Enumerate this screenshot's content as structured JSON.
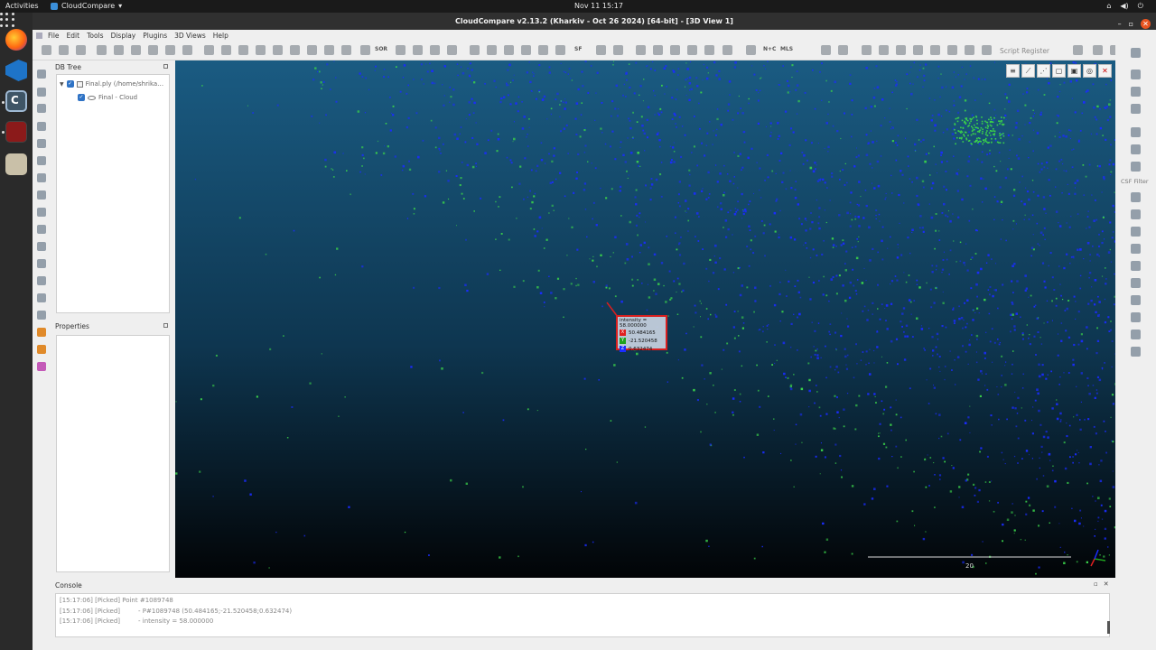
{
  "topbar": {
    "activities": "Activities",
    "app_name": "CloudCompare",
    "clock": "Nov 11  15:17"
  },
  "window": {
    "title": "CloudCompare v2.13.2 (Kharkiv - Oct 26 2024) [64-bit] - [3D View 1]"
  },
  "menu": {
    "items": [
      "File",
      "Edit",
      "Tools",
      "Display",
      "Plugins",
      "3D Views",
      "Help"
    ]
  },
  "toolbar": {
    "sor_label": "SOR",
    "sf_label": "SF",
    "nc_label": "N+C",
    "mls_label": "MLS",
    "script_register": "Script Register"
  },
  "db_tree": {
    "title": "DB Tree",
    "file_item": "Final.ply (/home/shrika…",
    "cloud_item": "Final - Cloud"
  },
  "properties": {
    "title": "Properties"
  },
  "picked_label": {
    "header": "intensity = 58.000000",
    "x_axis": "X",
    "x": "50.484165",
    "y_axis": "Y",
    "y": "-21.520458",
    "z_axis": "Z",
    "z": "0.632474"
  },
  "scale_bar": {
    "value": "20"
  },
  "right_toolbar": {
    "csf_label": "CSF Filter"
  },
  "console": {
    "title": "Console",
    "lines": [
      "[15:17:06] [Picked] Point #1089748",
      "[15:17:06] [Picked]         - P#1089748 (50.484165;-21.520458;0.632474)",
      "[15:17:06] [Picked]         - intensity = 58.000000"
    ]
  },
  "colors": {
    "view_top": "#1a5b82",
    "view_bottom": "#020406",
    "points_blue": "#1a2cff",
    "points_green": "#3ad14a",
    "label_border": "#d91f1f",
    "axis_x": "#e02020",
    "axis_y": "#1fa21f",
    "axis_z": "#1a2cff"
  }
}
